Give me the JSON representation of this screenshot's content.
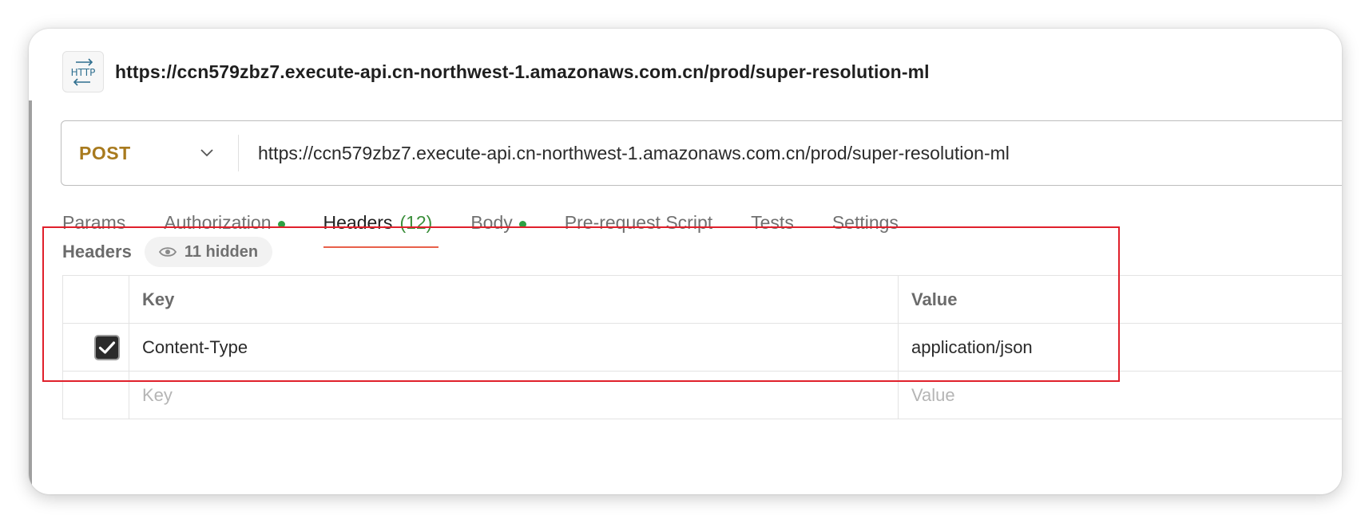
{
  "request": {
    "icon_text": "HTTP",
    "title": "https://ccn579zbz7.execute-api.cn-northwest-1.amazonaws.com.cn/prod/super-resolution-ml"
  },
  "urlbar": {
    "method": "POST",
    "url": "https://ccn579zbz7.execute-api.cn-northwest-1.amazonaws.com.cn/prod/super-resolution-ml"
  },
  "tabs": [
    {
      "label": "Params"
    },
    {
      "label": "Authorization"
    },
    {
      "label": "Headers",
      "count": "(12)"
    },
    {
      "label": "Body"
    },
    {
      "label": "Pre-request Script"
    },
    {
      "label": "Tests"
    },
    {
      "label": "Settings"
    }
  ],
  "headers_section": {
    "title": "Headers",
    "hidden_label": "11 hidden"
  },
  "table": {
    "columns": {
      "key": "Key",
      "value": "Value"
    },
    "rows": [
      {
        "checked": true,
        "key": "Content-Type",
        "value": "application/json"
      }
    ],
    "placeholder": {
      "key": "Key",
      "value": "Value"
    }
  },
  "colors": {
    "method": "#a87a1e",
    "status_dot": "#2ea043",
    "header_count": "#3b8f3b",
    "annotation_box": "#e0202b"
  }
}
